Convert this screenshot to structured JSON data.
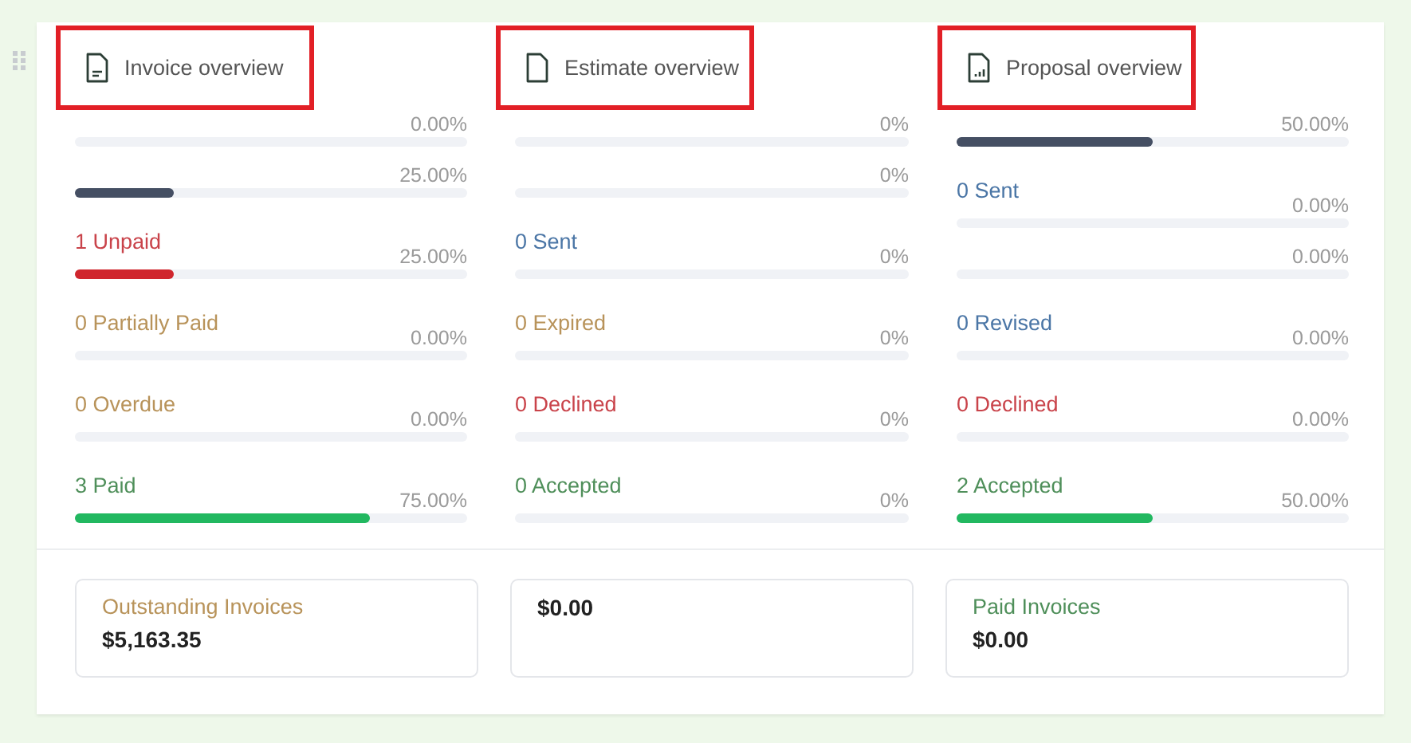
{
  "columns": [
    {
      "title": "Invoice overview",
      "highlighted": true,
      "rows": [
        {
          "label": null,
          "reading": "0.00%"
        },
        {
          "label": null,
          "kind": "neutral",
          "reading": "25.00%",
          "level": 0.25
        },
        {
          "label": "1 Unpaid",
          "kind": "danger",
          "reading": "25.00%",
          "level": 0.25
        },
        {
          "label": "0 Partially Paid",
          "kind": "warning",
          "reading": "0.00%"
        },
        {
          "label": "0 Overdue",
          "kind": "warning",
          "reading": "0.00%"
        },
        {
          "label": "3 Paid",
          "kind": "success",
          "reading": "75.00%",
          "level": 0.75
        }
      ]
    },
    {
      "title": "Estimate overview",
      "highlighted": true,
      "rows": [
        {
          "label": null,
          "reading": "0%"
        },
        {
          "label": null,
          "reading": "0%"
        },
        {
          "label": "0 Sent",
          "kind": "info",
          "reading": "0%"
        },
        {
          "label": "0 Expired",
          "kind": "warning",
          "reading": "0%"
        },
        {
          "label": "0 Declined",
          "kind": "danger",
          "reading": "0%"
        },
        {
          "label": "0 Accepted",
          "kind": "success",
          "reading": "0%"
        }
      ]
    },
    {
      "title": "Proposal overview",
      "highlighted": true,
      "rows": [
        {
          "label": null,
          "kind": "neutral",
          "reading": "50.00%",
          "level": 0.5
        },
        {
          "label": "0 Sent",
          "kind": "info",
          "reading": "0.00%"
        },
        {
          "label": null,
          "reading": "0.00%"
        },
        {
          "label": "0 Revised",
          "kind": "info",
          "reading": "0.00%"
        },
        {
          "label": "0 Declined",
          "kind": "danger",
          "reading": "0.00%"
        },
        {
          "label": "2 Accepted",
          "kind": "success",
          "reading": "50.00%",
          "level": 0.5
        }
      ]
    }
  ],
  "summary_cards": [
    {
      "title": "Outstanding Invoices",
      "kind": "warning",
      "amount": "$5,163.35"
    },
    {
      "amount": "$0.00"
    },
    {
      "title": "Paid Invoices",
      "kind": "success",
      "amount": "$0.00"
    }
  ]
}
